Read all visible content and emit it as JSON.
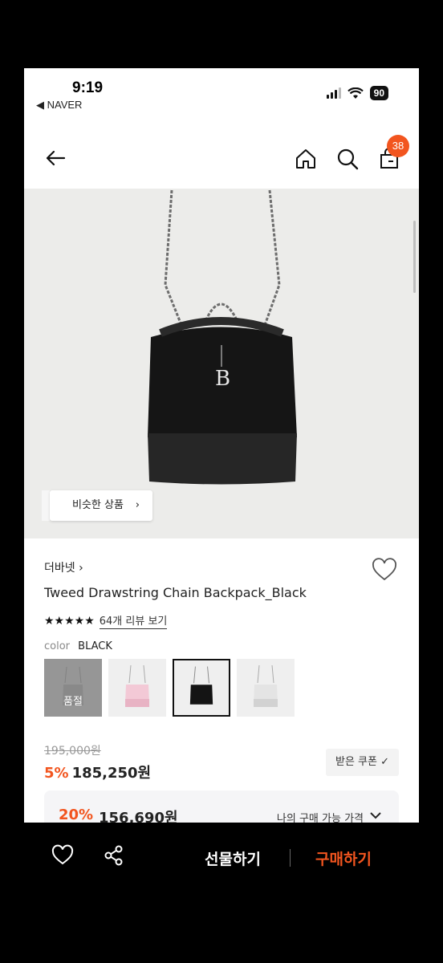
{
  "status_bar": {
    "time": "9:19",
    "back_app": "◀ NAVER",
    "battery": "90"
  },
  "header": {
    "cart_count": "38"
  },
  "hero": {
    "similar_label": "비슷한 상품",
    "similar_chevron": "›"
  },
  "product": {
    "brand": "더바넷 ›",
    "name": "Tweed Drawstring Chain Backpack_Black",
    "stars": "★★★★★",
    "review_link": "64개 리뷰 보기",
    "rating_value": 5
  },
  "color": {
    "label": "color",
    "value": "BLACK",
    "soldout_label": "품절"
  },
  "pricing": {
    "original": "195,000원",
    "discount": "5%",
    "price": "185,250원",
    "coupon_button": "받은 쿠폰 ✓",
    "coupon_discount": "20%",
    "coupon_price": "156,690원",
    "coupon_label": "나의 구매 가능 가격"
  },
  "bottom_bar": {
    "gift": "선물하기",
    "buy": "구매하기"
  },
  "colors": {
    "accent": "#f2551f",
    "background": "#000000"
  },
  "icons": [
    "back-arrow-icon",
    "home-icon",
    "search-icon",
    "cart-icon",
    "heart-icon",
    "share-icon"
  ]
}
